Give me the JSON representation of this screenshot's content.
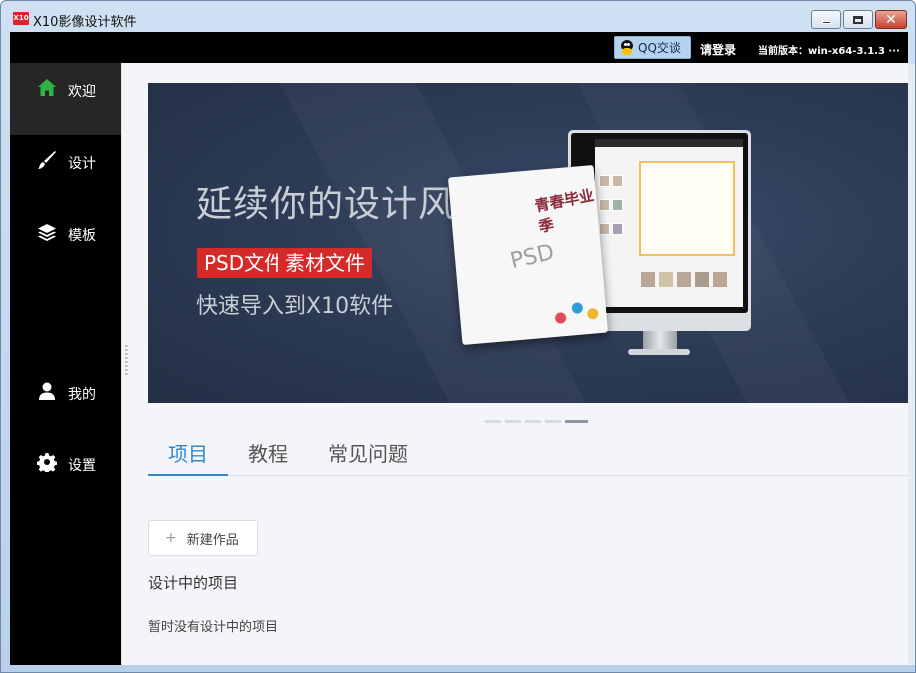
{
  "window": {
    "title": "X10影像设计软件",
    "icon_text": "X10",
    "controls": [
      "minimize",
      "maximize",
      "close"
    ],
    "close_glyph": "✕"
  },
  "topbar": {
    "qq_button": "QQ交谈",
    "login": "请登录",
    "version": "当前版本：win-x64-3.1.3 ···"
  },
  "sidebar": {
    "items": [
      {
        "label": "欢迎",
        "icon": "home-icon",
        "active": true
      },
      {
        "label": "设计",
        "icon": "brush-icon",
        "active": false
      },
      {
        "label": "模板",
        "icon": "layers-icon",
        "active": false
      },
      {
        "label": "我的",
        "icon": "user-icon",
        "active": false
      },
      {
        "label": "设置",
        "icon": "gear-icon",
        "active": false
      }
    ]
  },
  "banner": {
    "headline": "延续你的设计风格",
    "tags": [
      "PSD文件",
      "素材文件"
    ],
    "subline": "快速导入到X10软件",
    "poster_word": "PSD",
    "poster_art": "青春毕业季",
    "slides_count": 5,
    "active_slide": 5
  },
  "tabs": [
    {
      "label": "项目",
      "active": true
    },
    {
      "label": "教程",
      "active": false
    },
    {
      "label": "常见问题",
      "active": false
    }
  ],
  "projects": {
    "new_button": "新建作品",
    "plus": "+",
    "section_title": "设计中的项目",
    "empty_text": "暂时没有设计中的项目"
  },
  "colors": {
    "accent": "#2f87d0",
    "tag_red": "#d52a2a",
    "sidebar_bg": "#000000",
    "home_icon_green": "#2fb344"
  }
}
